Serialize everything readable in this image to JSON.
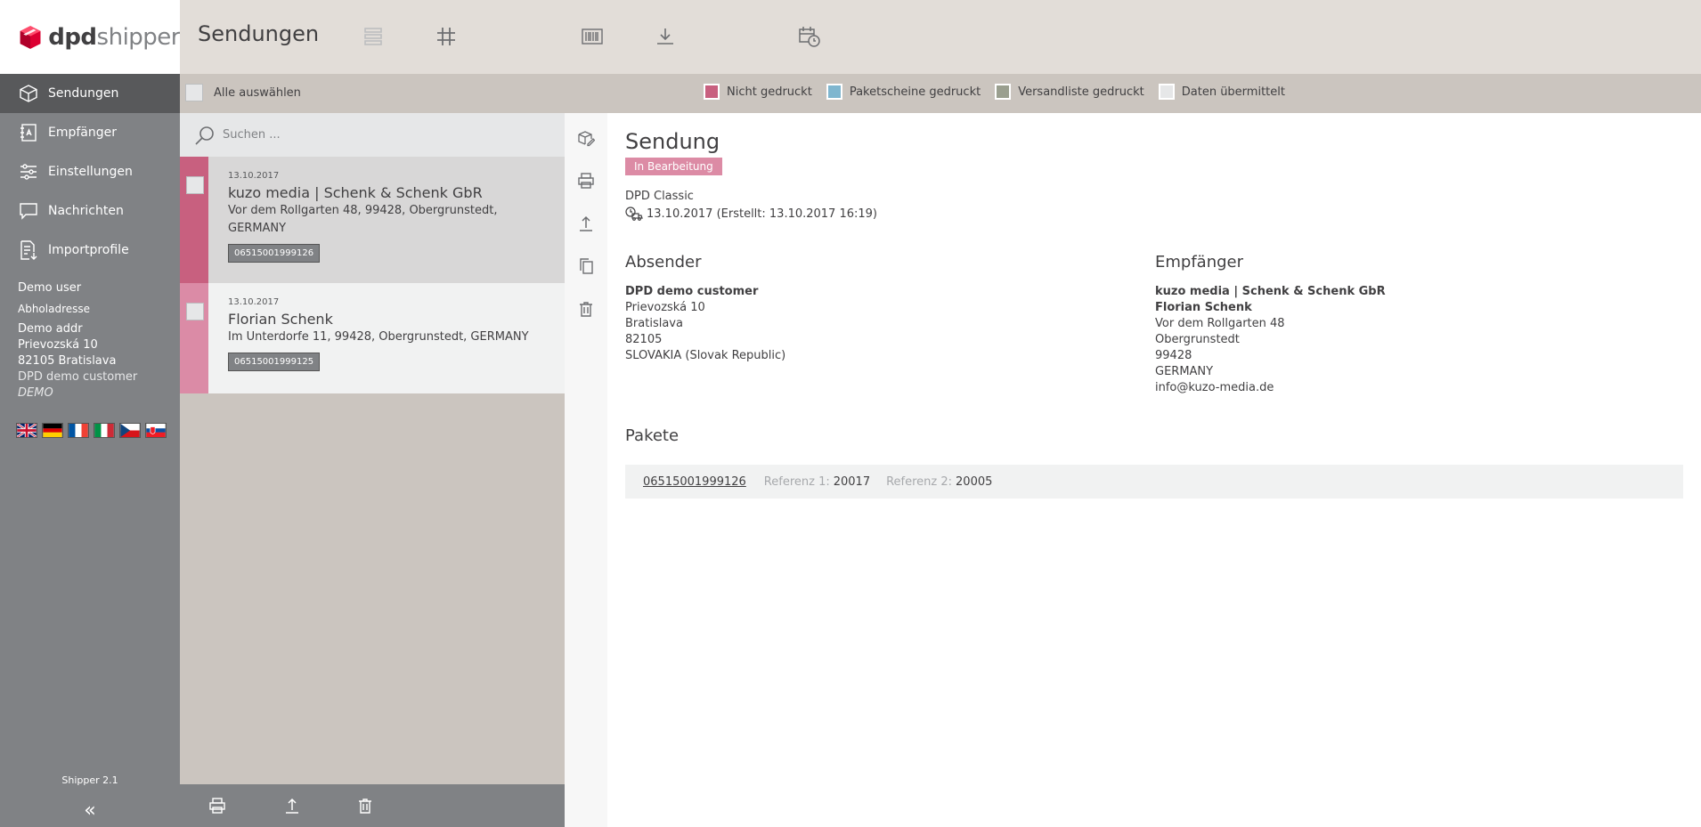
{
  "logo": {
    "brand": "dpd",
    "product": "shipper"
  },
  "header": {
    "title": "Sendungen"
  },
  "sidebar": {
    "items": [
      {
        "label": "Sendungen"
      },
      {
        "label": "Empfänger"
      },
      {
        "label": "Einstellungen"
      },
      {
        "label": "Nachrichten"
      },
      {
        "label": "Importprofile"
      }
    ],
    "user": {
      "name": "Demo user",
      "pickup_label": "Abholadresse",
      "addr_name": "Demo addr",
      "street": "Prievozská 10",
      "city": "82105 Bratislava",
      "customer": "DPD demo customer",
      "tag": "DEMO"
    },
    "version": "Shipper 2.1",
    "collapse": "«"
  },
  "filterbar": {
    "select_all": "Alle auswählen",
    "legend": [
      {
        "label": "Nicht gedruckt",
        "color": "#c8607f"
      },
      {
        "label": "Paketscheine gedruckt",
        "color": "#7fb6cf"
      },
      {
        "label": "Versandliste gedruckt",
        "color": "#9a9f8f"
      },
      {
        "label": "Daten übermittelt",
        "color": "#e6e7e8"
      }
    ]
  },
  "search": {
    "placeholder": "Suchen ..."
  },
  "shipments": [
    {
      "date": "13.10.2017",
      "name": "kuzo media | Schenk & Schenk GbR",
      "addr1": "Vor dem Rollgarten 48, 99428, Obergrunstedt,",
      "addr2": "GERMANY",
      "parcel": "06515001999126"
    },
    {
      "date": "13.10.2017",
      "name": "Florian Schenk",
      "addr1": "Im Unterdorfe 11, 99428, Obergrunstedt, GERMANY",
      "addr2": "",
      "parcel": "06515001999125"
    }
  ],
  "detail": {
    "title": "Sendung",
    "status": "In Bearbeitung",
    "service": "DPD Classic",
    "dateline": "13.10.2017 (Erstellt: 13.10.2017 16:19)",
    "sender": {
      "heading": "Absender",
      "lines": [
        "DPD demo customer",
        "Prievozská 10",
        "Bratislava",
        "82105",
        "SLOVAKIA (Slovak Republic)"
      ]
    },
    "recipient": {
      "heading": "Empfänger",
      "lines": [
        "kuzo media | Schenk & Schenk GbR",
        "Florian Schenk",
        "Vor dem Rollgarten 48",
        "Obergrunstedt",
        "99428",
        "GERMANY",
        "info@kuzo-media.de"
      ]
    },
    "packages": {
      "heading": "Pakete",
      "items": [
        {
          "tracking": "06515001999126",
          "ref1_label": "Referenz 1:",
          "ref1": "20017",
          "ref2_label": "Referenz 2:",
          "ref2": "20005"
        }
      ]
    }
  },
  "colors": {
    "sidebar": "#808285",
    "sidebar_active": "#58595b",
    "topbar": "#e2ddd8",
    "filterbar": "#cbc5bf",
    "dpd_red": "#dc0032",
    "status": "#dc8ba5"
  }
}
